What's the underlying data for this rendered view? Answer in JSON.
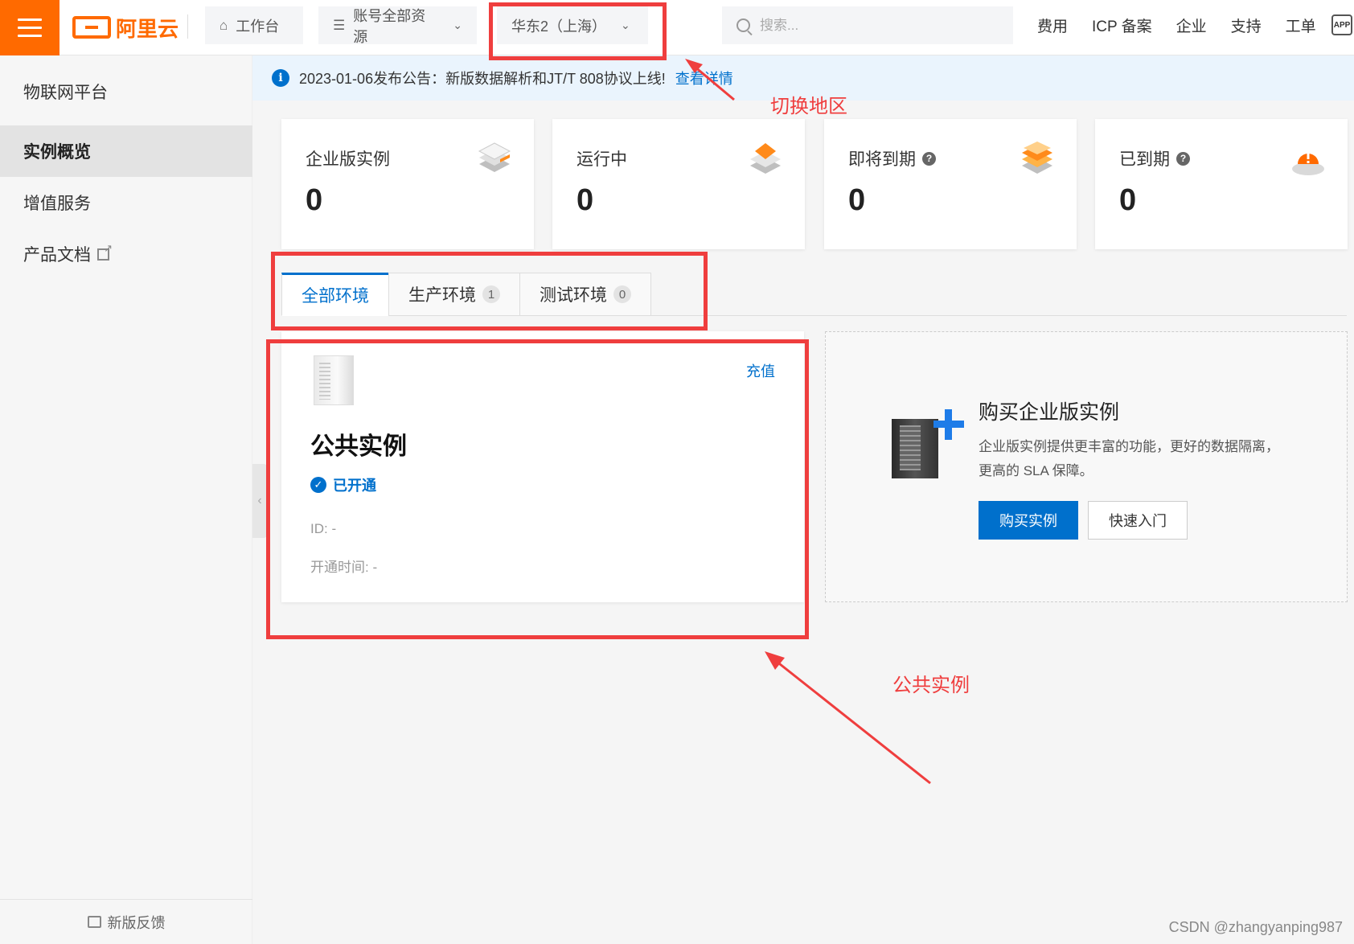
{
  "header": {
    "logo_text": "阿里云",
    "workbench_label": "工作台",
    "resources_label": "账号全部资源",
    "region_label": "华东2（上海）",
    "search_placeholder": "搜索...",
    "links": [
      "费用",
      "ICP 备案",
      "企业",
      "支持",
      "工单"
    ],
    "app_badge": "APP"
  },
  "sidebar": {
    "title": "物联网平台",
    "items": [
      {
        "label": "实例概览",
        "active": true
      },
      {
        "label": "增值服务",
        "active": false
      },
      {
        "label": "产品文档",
        "active": false
      }
    ],
    "feedback_label": "新版反馈"
  },
  "notice": {
    "text": "2023-01-06发布公告：新版数据解析和JT/T 808协议上线!",
    "link": "查看详情"
  },
  "stats": [
    {
      "label": "企业版实例",
      "value": "0",
      "help": false
    },
    {
      "label": "运行中",
      "value": "0",
      "help": false
    },
    {
      "label": "即将到期",
      "value": "0",
      "help": true
    },
    {
      "label": "已到期",
      "value": "0",
      "help": true
    }
  ],
  "tabs": [
    {
      "label": "全部环境",
      "count": null,
      "active": true
    },
    {
      "label": "生产环境",
      "count": "1",
      "active": false
    },
    {
      "label": "测试环境",
      "count": "0",
      "active": false
    }
  ],
  "public_instance": {
    "recharge": "充值",
    "title": "公共实例",
    "status": "已开通",
    "id_label": "ID:  -",
    "open_time_label": "开通时间:  -"
  },
  "buy_card": {
    "title": "购买企业版实例",
    "description": "企业版实例提供更丰富的功能，更好的数据隔离，更高的 SLA 保障。",
    "buy_button": "购买实例",
    "quickstart_button": "快速入门"
  },
  "annotations": {
    "switch_region": "切换地区",
    "public_instance": "公共实例"
  },
  "watermark": "CSDN @zhangyanping987",
  "colors": {
    "brand_orange": "#ff6a00",
    "primary_blue": "#0070cc",
    "annotation_red": "#ef3e3e"
  }
}
